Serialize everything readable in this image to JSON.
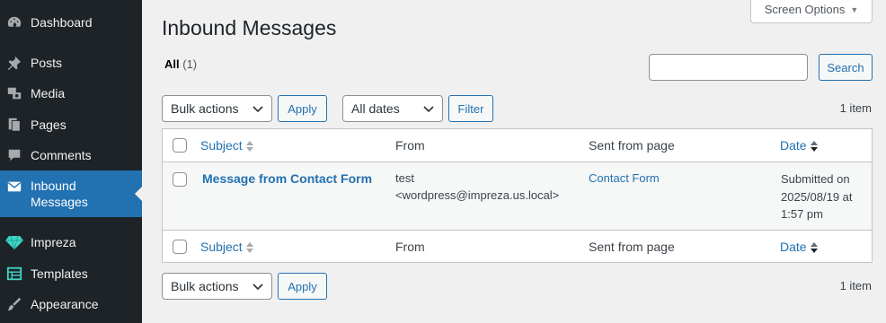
{
  "sidebar": {
    "items": [
      {
        "label": "Dashboard",
        "icon": "dashboard-icon"
      },
      {
        "label": "Posts",
        "icon": "pin-icon"
      },
      {
        "label": "Media",
        "icon": "media-icon"
      },
      {
        "label": "Pages",
        "icon": "pages-icon"
      },
      {
        "label": "Comments",
        "icon": "comments-icon"
      },
      {
        "label_line1": "Inbound",
        "label_line2": "Messages",
        "icon": "envelope-icon",
        "active": true
      },
      {
        "label": "Impreza",
        "icon": "diamond-icon"
      },
      {
        "label": "Templates",
        "icon": "templates-icon"
      },
      {
        "label": "Appearance",
        "icon": "brush-icon"
      }
    ]
  },
  "screen_options": {
    "label": "Screen Options"
  },
  "page": {
    "title": "Inbound Messages"
  },
  "views": {
    "all_label": "All",
    "all_count": "(1)"
  },
  "search": {
    "value": "",
    "button": "Search"
  },
  "top_nav": {
    "bulk_actions": "Bulk actions",
    "apply": "Apply",
    "dates": "All dates",
    "filter": "Filter",
    "count": "1 item"
  },
  "table": {
    "columns": {
      "subject": "Subject",
      "from": "From",
      "sent_from": "Sent from page",
      "date": "Date"
    },
    "rows": [
      {
        "subject": "Message from Contact Form",
        "from_line1": "test",
        "from_line2": "<wordpress@impreza.us.local>",
        "sent_from": "Contact Form",
        "date_line1": "Submitted on",
        "date_line2": "2025/08/19 at",
        "date_line3": "1:57 pm"
      }
    ]
  },
  "bottom_nav": {
    "bulk_actions": "Bulk actions",
    "apply": "Apply",
    "count": "1 item"
  },
  "colors": {
    "sidebar_bg": "#1d2327",
    "active_bg": "#2271b1",
    "link": "#2271b1",
    "page_bg": "#f0f0f1"
  }
}
